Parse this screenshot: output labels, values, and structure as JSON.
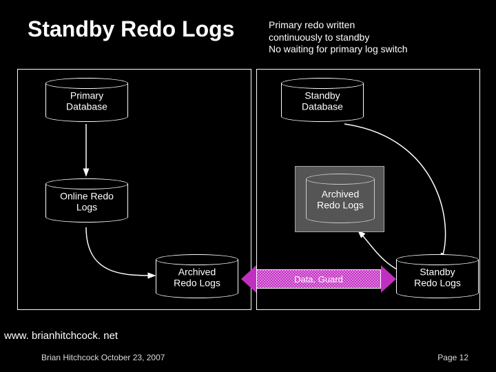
{
  "title": "Standby Redo Logs",
  "note_line1": "Primary redo written",
  "note_line2": "continuously to standby",
  "note_line3": "No waiting for primary log switch",
  "left": {
    "primary_db": "Primary\nDatabase",
    "online_redo": "Online Redo\nLogs",
    "archived_redo": "Archived\nRedo Logs"
  },
  "right": {
    "standby_db": "Standby\nDatabase",
    "archived_redo": "Archived\nRedo Logs",
    "standby_redo": "Standby\nRedo Logs"
  },
  "dataguard_label": "Data. Guard",
  "footer": {
    "url": "www. brianhitchcock. net",
    "author": "Brian Hitchcock  October 23, 2007",
    "page": "Page 12"
  }
}
